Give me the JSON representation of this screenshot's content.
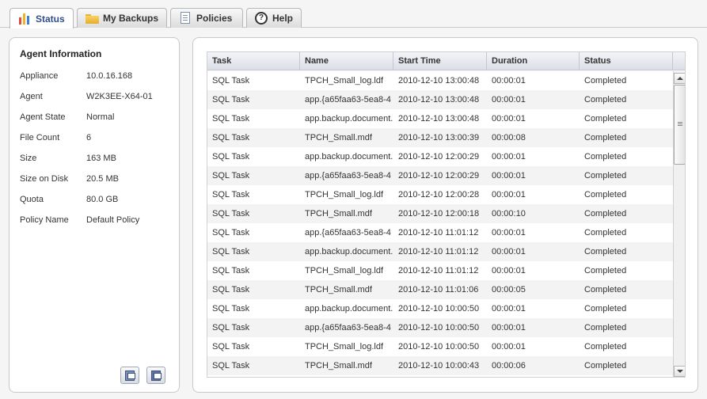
{
  "tabs": [
    {
      "label": "Status",
      "icon": "bar-chart-icon",
      "active": true
    },
    {
      "label": "My Backups",
      "icon": "folder-icon",
      "active": false
    },
    {
      "label": "Policies",
      "icon": "document-icon",
      "active": false
    },
    {
      "label": "Help",
      "icon": "help-icon",
      "active": false
    }
  ],
  "agent_info": {
    "title": "Agent Information",
    "rows": [
      {
        "label": "Appliance",
        "value": "10.0.16.168"
      },
      {
        "label": "Agent",
        "value": "W2K3EE-X64-01"
      },
      {
        "label": "Agent State",
        "value": "Normal"
      },
      {
        "label": "File Count",
        "value": "6"
      },
      {
        "label": "Size",
        "value": "163 MB"
      },
      {
        "label": "Size on Disk",
        "value": "20.5 MB"
      },
      {
        "label": "Quota",
        "value": "80.0 GB"
      },
      {
        "label": "Policy Name",
        "value": "Default Policy"
      }
    ],
    "buttons": [
      {
        "icon": "restore-icon"
      },
      {
        "icon": "properties-icon"
      }
    ]
  },
  "grid": {
    "columns": [
      "Task",
      "Name",
      "Start Time",
      "Duration",
      "Status"
    ],
    "rows": [
      [
        "SQL Task",
        "TPCH_Small_log.ldf",
        "2010-12-10 13:00:48",
        "00:00:01",
        "Completed"
      ],
      [
        "SQL Task",
        "app.{a65faa63-5ea8-4",
        "2010-12-10 13:00:48",
        "00:00:01",
        "Completed"
      ],
      [
        "SQL Task",
        "app.backup.document.",
        "2010-12-10 13:00:48",
        "00:00:01",
        "Completed"
      ],
      [
        "SQL Task",
        "TPCH_Small.mdf",
        "2010-12-10 13:00:39",
        "00:00:08",
        "Completed"
      ],
      [
        "SQL Task",
        "app.backup.document.",
        "2010-12-10 12:00:29",
        "00:00:01",
        "Completed"
      ],
      [
        "SQL Task",
        "app.{a65faa63-5ea8-4",
        "2010-12-10 12:00:29",
        "00:00:01",
        "Completed"
      ],
      [
        "SQL Task",
        "TPCH_Small_log.ldf",
        "2010-12-10 12:00:28",
        "00:00:01",
        "Completed"
      ],
      [
        "SQL Task",
        "TPCH_Small.mdf",
        "2010-12-10 12:00:18",
        "00:00:10",
        "Completed"
      ],
      [
        "SQL Task",
        "app.{a65faa63-5ea8-4",
        "2010-12-10 11:01:12",
        "00:00:01",
        "Completed"
      ],
      [
        "SQL Task",
        "app.backup.document.",
        "2010-12-10 11:01:12",
        "00:00:01",
        "Completed"
      ],
      [
        "SQL Task",
        "TPCH_Small_log.ldf",
        "2010-12-10 11:01:12",
        "00:00:01",
        "Completed"
      ],
      [
        "SQL Task",
        "TPCH_Small.mdf",
        "2010-12-10 11:01:06",
        "00:00:05",
        "Completed"
      ],
      [
        "SQL Task",
        "app.backup.document.",
        "2010-12-10 10:00:50",
        "00:00:01",
        "Completed"
      ],
      [
        "SQL Task",
        "app.{a65faa63-5ea8-4",
        "2010-12-10 10:00:50",
        "00:00:01",
        "Completed"
      ],
      [
        "SQL Task",
        "TPCH_Small_log.ldf",
        "2010-12-10 10:00:50",
        "00:00:01",
        "Completed"
      ],
      [
        "SQL Task",
        "TPCH_Small.mdf",
        "2010-12-10 10:00:43",
        "00:00:06",
        "Completed"
      ]
    ]
  },
  "colors": {
    "active_tab_text": "#2f4f86",
    "bar_colors": [
      "#e44a3c",
      "#f0b323",
      "#3b7fd6"
    ]
  }
}
